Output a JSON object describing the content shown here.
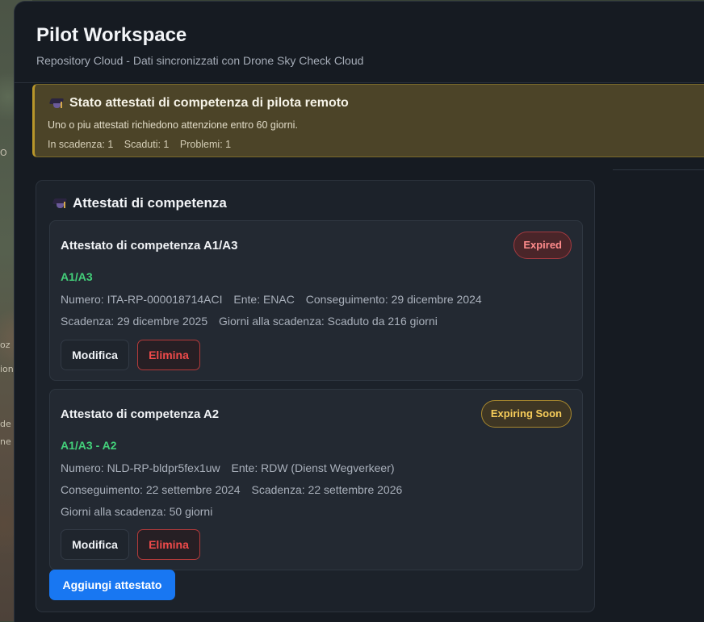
{
  "app": {
    "title": "Pilot Workspace",
    "subtitle": "Repository Cloud - Dati sincronizzati con Drone Sky Check Cloud"
  },
  "alert": {
    "icon": "graduation-cap-icon",
    "title": "Stato attestati di competenza di pilota remoto",
    "message": "Uno o piu attestati richiedono attenzione entro 60 giorni.",
    "counts": {
      "expiring": "In scadenza: 1",
      "expired": "Scaduti: 1",
      "problems": "Problemi: 1"
    },
    "colors": {
      "border": "#b8962a",
      "background": "#4c4428"
    }
  },
  "panel": {
    "icon": "graduation-cap-icon",
    "title": "Attestati di competenza",
    "add_label": "Aggiungi attestato"
  },
  "certificates": [
    {
      "title": "Attestato di competenza A1/A3",
      "status": "Expired",
      "category": "A1/A3",
      "lines": [
        [
          "Numero: ITA-RP-000018714ACI",
          "Ente: ENAC",
          "Conseguimento: 29 dicembre 2024"
        ],
        [
          "Scadenza: 29 dicembre 2025",
          "Giorni alla scadenza: Scaduto da 216 giorni"
        ]
      ],
      "edit_label": "Modifica",
      "delete_label": "Elimina"
    },
    {
      "title": "Attestato di competenza A2",
      "status": "Expiring Soon",
      "category": "A1/A3 - A2",
      "lines": [
        [
          "Numero: NLD-RP-bldpr5fex1uw",
          "Ente: RDW (Dienst Wegverkeer)"
        ],
        [
          "Conseguimento: 22 settembre 2024",
          "Scadenza: 22 settembre 2026"
        ],
        [
          "Giorni alla scadenza: 50 giorni"
        ]
      ],
      "edit_label": "Modifica",
      "delete_label": "Elimina"
    }
  ],
  "background_map": {
    "fragments": [
      "O",
      "oz",
      "ion",
      "de",
      "ne"
    ]
  },
  "colors": {
    "accent": "#1877f2",
    "category_green": "#43d07a",
    "expired_red": "#ff8c8c",
    "expiring_yellow": "#f7cd5a",
    "delete_red": "#ef4a4a"
  }
}
